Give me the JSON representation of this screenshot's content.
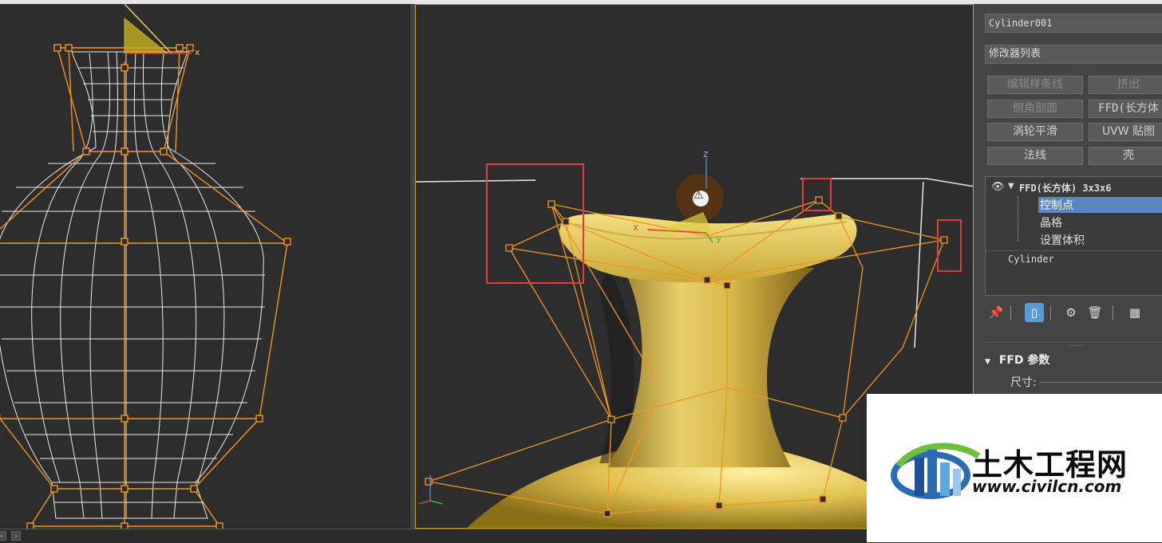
{
  "viewports": {
    "left": {
      "label": "front-wireframe-viewport"
    },
    "right": {
      "label": "perspective-viewport"
    }
  },
  "gizmo": {
    "axis_x": "x",
    "axis_y": "y",
    "axis_z": "z",
    "warn_glyph": "⚠"
  },
  "panel": {
    "object_name": "Cylinder001",
    "modifier_list": "修改器列表",
    "buttons": [
      {
        "label": "编辑样条线",
        "enabled": false
      },
      {
        "label": "挤出",
        "enabled": false
      },
      {
        "label": "倒角剖面",
        "enabled": false
      },
      {
        "label": "FFD(长方体",
        "enabled": true
      },
      {
        "label": "涡轮平滑",
        "enabled": true
      },
      {
        "label": "UVW 贴图",
        "enabled": true
      },
      {
        "label": "法线",
        "enabled": true
      },
      {
        "label": "壳",
        "enabled": true
      }
    ],
    "stack": {
      "modifier": "FFD(长方体) 3x3x6",
      "sub_items": [
        "控制点",
        "晶格",
        "设置体积"
      ],
      "selected_sub": "控制点",
      "base": "Cylinder"
    },
    "tools": [
      "pin-icon",
      "show-end-result-icon",
      "make-unique-icon",
      "remove-modifier-icon",
      "configure-sets-icon"
    ],
    "separator_dots": ".......",
    "rollout_title": "FFD 参数",
    "dimensions_label": "尺寸:"
  },
  "watermark": {
    "title": "土木工程网",
    "url": "www.civilcn.com"
  },
  "colors": {
    "accent_orange": "#f0961e",
    "selection_blue": "#5a86c0",
    "highlight_red": "#e03c3c",
    "vase_gold": "#e8cf6a"
  }
}
